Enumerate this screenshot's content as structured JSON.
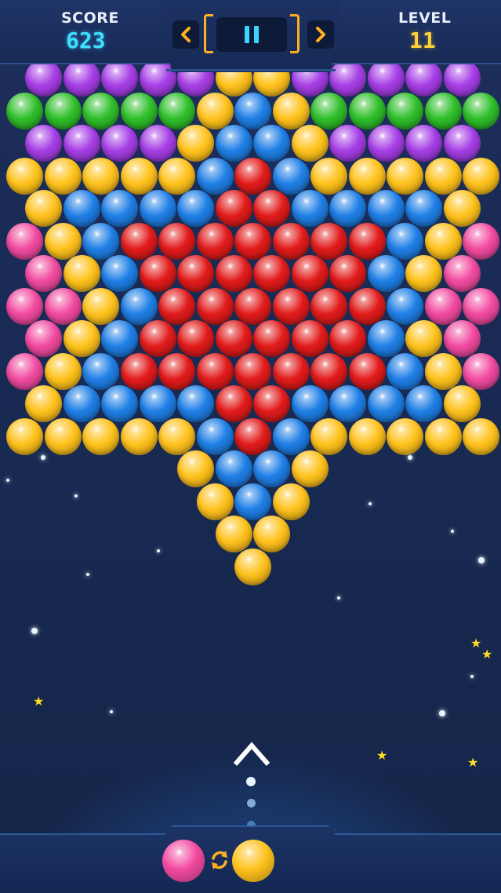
{
  "hud": {
    "score_label": "SCORE",
    "score_value": "623",
    "level_label": "LEVEL",
    "level_value": "11"
  },
  "controls": {
    "prev_icon": "chevron-left-icon",
    "next_icon": "chevron-right-icon",
    "pause_icon": "pause-icon",
    "swap_icon": "swap-icon",
    "aim_icon": "chevron-up-icon"
  },
  "colors": {
    "purple": "#a63ee6",
    "green": "#2fbf2a",
    "yellow": "#ffc21c",
    "blue": "#1f7fe6",
    "red": "#e21b1b",
    "pink": "#f24aa0"
  },
  "bubble_grid": [
    "PPPPPYYPPPPP",
    "GGGGGYBYGGGGG",
    "PPPPYBBYPPPP",
    "YYYYYBRBYYYYY",
    "YBBBBRRBBBBY",
    "KYBRRRRRRRBYK",
    "KYBRRRRRRBYK",
    "KKYBRRRRRRBKK",
    "KYBRRRRRRBYK",
    "KYBRRRRRRRBYK",
    "YBBBBRRBBBBY",
    "YYYYYBRBYYYYY",
    "....YBBY....",
    ".....YBY.....",
    ".....YY.....",
    "......Y......"
  ],
  "shooter": {
    "current_ball": "pink",
    "next_ball": "yellow"
  }
}
